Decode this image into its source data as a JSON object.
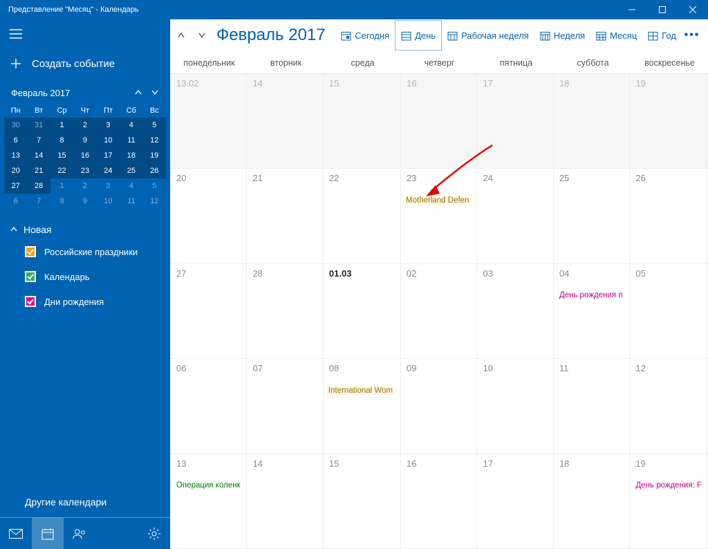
{
  "window": {
    "title": "Представление \"Месяц\" - Календарь"
  },
  "sidebar": {
    "new_event": "Создать событие",
    "mini_month": "Февраль 2017",
    "dow": [
      "Пн",
      "Вт",
      "Ср",
      "Чт",
      "Пт",
      "Сб",
      "Вс"
    ],
    "mini_cells": [
      {
        "d": "30",
        "cls": "out-dark"
      },
      {
        "d": "31",
        "cls": "out-dark"
      },
      {
        "d": "1",
        "cls": "cur"
      },
      {
        "d": "2",
        "cls": "cur"
      },
      {
        "d": "3",
        "cls": "cur"
      },
      {
        "d": "4",
        "cls": "cur"
      },
      {
        "d": "5",
        "cls": "cur"
      },
      {
        "d": "6",
        "cls": "cur"
      },
      {
        "d": "7",
        "cls": "cur"
      },
      {
        "d": "8",
        "cls": "cur"
      },
      {
        "d": "9",
        "cls": "cur"
      },
      {
        "d": "10",
        "cls": "cur"
      },
      {
        "d": "11",
        "cls": "cur"
      },
      {
        "d": "12",
        "cls": "cur"
      },
      {
        "d": "13",
        "cls": "cur"
      },
      {
        "d": "14",
        "cls": "cur"
      },
      {
        "d": "15",
        "cls": "cur"
      },
      {
        "d": "16",
        "cls": "cur"
      },
      {
        "d": "17",
        "cls": "cur"
      },
      {
        "d": "18",
        "cls": "cur"
      },
      {
        "d": "19",
        "cls": "cur"
      },
      {
        "d": "20",
        "cls": "cur"
      },
      {
        "d": "21",
        "cls": "cur"
      },
      {
        "d": "22",
        "cls": "cur"
      },
      {
        "d": "23",
        "cls": "cur"
      },
      {
        "d": "24",
        "cls": "cur"
      },
      {
        "d": "25",
        "cls": "cur"
      },
      {
        "d": "26",
        "cls": "cur"
      },
      {
        "d": "27",
        "cls": "cur"
      },
      {
        "d": "28",
        "cls": "cur"
      },
      {
        "d": "1",
        "cls": "out"
      },
      {
        "d": "2",
        "cls": "out"
      },
      {
        "d": "3",
        "cls": "out"
      },
      {
        "d": "4",
        "cls": "out"
      },
      {
        "d": "5",
        "cls": "out"
      },
      {
        "d": "6",
        "cls": "out"
      },
      {
        "d": "7",
        "cls": "out"
      },
      {
        "d": "8",
        "cls": "out"
      },
      {
        "d": "9",
        "cls": "out"
      },
      {
        "d": "10",
        "cls": "out"
      },
      {
        "d": "11",
        "cls": "out"
      },
      {
        "d": "12",
        "cls": "out"
      }
    ],
    "section_new": "Новая",
    "cals": [
      {
        "label": "Российские праздники",
        "color": "#f0a30a"
      },
      {
        "label": "Календарь",
        "color": "#34a853"
      },
      {
        "label": "Дни рождения",
        "color": "#e3008c"
      }
    ],
    "other": "Другие календари"
  },
  "toolbar": {
    "month": "Февраль 2017",
    "today": "Сегодня",
    "day": "День",
    "workweek": "Рабочая неделя",
    "week": "Неделя",
    "month_btn": "Месяц",
    "year": "Год"
  },
  "dow": [
    "понедельник",
    "вторник",
    "среда",
    "четверг",
    "пятница",
    "суббота",
    "воскресенье"
  ],
  "cells": [
    {
      "d": "13.02",
      "cls": "out"
    },
    {
      "d": "14",
      "cls": "out"
    },
    {
      "d": "15",
      "cls": "out"
    },
    {
      "d": "16",
      "cls": "out"
    },
    {
      "d": "17",
      "cls": "out"
    },
    {
      "d": "18",
      "cls": "out"
    },
    {
      "d": "19",
      "cls": "out"
    },
    {
      "d": "20",
      "cls": ""
    },
    {
      "d": "21",
      "cls": ""
    },
    {
      "d": "22",
      "cls": ""
    },
    {
      "d": "23",
      "cls": "",
      "ev": {
        "t": "Motherland Defen",
        "k": "holiday"
      }
    },
    {
      "d": "24",
      "cls": ""
    },
    {
      "d": "25",
      "cls": ""
    },
    {
      "d": "26",
      "cls": ""
    },
    {
      "d": "27",
      "cls": ""
    },
    {
      "d": "28",
      "cls": ""
    },
    {
      "d": "01.03",
      "cls": "today"
    },
    {
      "d": "02",
      "cls": ""
    },
    {
      "d": "03",
      "cls": ""
    },
    {
      "d": "04",
      "cls": "",
      "ev": {
        "t": "День рождения п",
        "k": "birthday"
      }
    },
    {
      "d": "05",
      "cls": ""
    },
    {
      "d": "06",
      "cls": ""
    },
    {
      "d": "07",
      "cls": ""
    },
    {
      "d": "08",
      "cls": "",
      "ev": {
        "t": "International Wom",
        "k": "holiday"
      }
    },
    {
      "d": "09",
      "cls": ""
    },
    {
      "d": "10",
      "cls": ""
    },
    {
      "d": "11",
      "cls": ""
    },
    {
      "d": "12",
      "cls": ""
    },
    {
      "d": "13",
      "cls": "",
      "ev": {
        "t": "Операция коленк",
        "k": "calgreen"
      }
    },
    {
      "d": "14",
      "cls": ""
    },
    {
      "d": "15",
      "cls": ""
    },
    {
      "d": "16",
      "cls": ""
    },
    {
      "d": "17",
      "cls": ""
    },
    {
      "d": "18",
      "cls": ""
    },
    {
      "d": "19",
      "cls": "",
      "ev": {
        "t": "День рождения: F",
        "k": "birthday"
      }
    }
  ]
}
